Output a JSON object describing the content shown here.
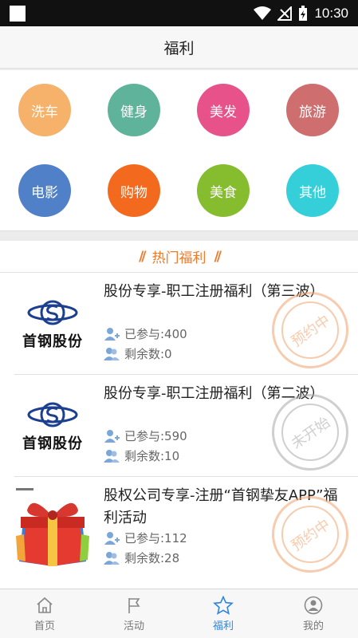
{
  "status_bar": {
    "time": "10:30"
  },
  "header": {
    "title": "福利"
  },
  "categories": [
    {
      "label": "洗车",
      "color": "#f6b26b"
    },
    {
      "label": "健身",
      "color": "#5fb39a"
    },
    {
      "label": "美发",
      "color": "#e8528a"
    },
    {
      "label": "旅游",
      "color": "#cf6e6e"
    },
    {
      "label": "电影",
      "color": "#4f80c8"
    },
    {
      "label": "购物",
      "color": "#f36a1f"
    },
    {
      "label": "美食",
      "color": "#86bd2e"
    },
    {
      "label": "其他",
      "color": "#35cfd9"
    }
  ],
  "hot_section": {
    "title": "热门福利"
  },
  "items": [
    {
      "logo_text": "首钢股份",
      "title": "股份专享-职工注册福利（第三波）",
      "joined": "已参与:400",
      "remaining": "剩余数:0",
      "stamp": "预约中",
      "stamp_color": "#f2a26b"
    },
    {
      "logo_text": "首钢股份",
      "title": "股份专享-职工注册福利（第二波）",
      "joined": "已参与:590",
      "remaining": "剩余数:10",
      "stamp": "未开始",
      "stamp_color": "#a8a8a8"
    },
    {
      "logo_text": "",
      "title": "股权公司专享-注册“首钢挚友APP”福利活动",
      "joined": "已参与:112",
      "remaining": "剩余数:28",
      "stamp": "预约中",
      "stamp_color": "#f2a26b"
    }
  ],
  "tabs": [
    {
      "label": "首页",
      "icon": "home-icon"
    },
    {
      "label": "活动",
      "icon": "flag-icon"
    },
    {
      "label": "福利",
      "icon": "star-icon",
      "active": true
    },
    {
      "label": "我的",
      "icon": "user-icon"
    }
  ]
}
